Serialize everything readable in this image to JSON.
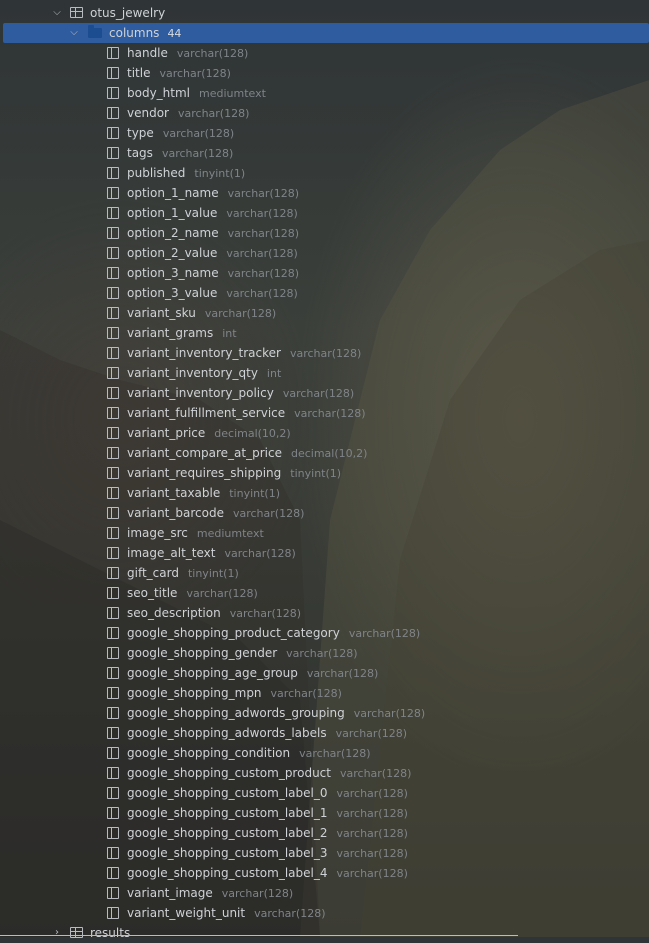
{
  "tree": {
    "table": {
      "name": "otus_jewelry",
      "expanded": true,
      "icon": "table-icon"
    },
    "columns_folder": {
      "label": "columns",
      "count": "44",
      "expanded": true,
      "selected": true,
      "icon": "folder-icon",
      "selected_color": "#2f5c9e"
    },
    "columns": [
      {
        "name": "handle",
        "type": "varchar(128)"
      },
      {
        "name": "title",
        "type": "varchar(128)"
      },
      {
        "name": "body_html",
        "type": "mediumtext"
      },
      {
        "name": "vendor",
        "type": "varchar(128)"
      },
      {
        "name": "type",
        "type": "varchar(128)"
      },
      {
        "name": "tags",
        "type": "varchar(128)"
      },
      {
        "name": "published",
        "type": "tinyint(1)"
      },
      {
        "name": "option_1_name",
        "type": "varchar(128)"
      },
      {
        "name": "option_1_value",
        "type": "varchar(128)"
      },
      {
        "name": "option_2_name",
        "type": "varchar(128)"
      },
      {
        "name": "option_2_value",
        "type": "varchar(128)"
      },
      {
        "name": "option_3_name",
        "type": "varchar(128)"
      },
      {
        "name": "option_3_value",
        "type": "varchar(128)"
      },
      {
        "name": "variant_sku",
        "type": "varchar(128)"
      },
      {
        "name": "variant_grams",
        "type": "int"
      },
      {
        "name": "variant_inventory_tracker",
        "type": "varchar(128)"
      },
      {
        "name": "variant_inventory_qty",
        "type": "int"
      },
      {
        "name": "variant_inventory_policy",
        "type": "varchar(128)"
      },
      {
        "name": "variant_fulfillment_service",
        "type": "varchar(128)"
      },
      {
        "name": "variant_price",
        "type": "decimal(10,2)"
      },
      {
        "name": "variant_compare_at_price",
        "type": "decimal(10,2)"
      },
      {
        "name": "variant_requires_shipping",
        "type": "tinyint(1)"
      },
      {
        "name": "variant_taxable",
        "type": "tinyint(1)"
      },
      {
        "name": "variant_barcode",
        "type": "varchar(128)"
      },
      {
        "name": "image_src",
        "type": "mediumtext"
      },
      {
        "name": "image_alt_text",
        "type": "varchar(128)"
      },
      {
        "name": "gift_card",
        "type": "tinyint(1)"
      },
      {
        "name": "seo_title",
        "type": "varchar(128)"
      },
      {
        "name": "seo_description",
        "type": "varchar(128)"
      },
      {
        "name": "google_shopping_product_category",
        "type": "varchar(128)"
      },
      {
        "name": "google_shopping_gender",
        "type": "varchar(128)"
      },
      {
        "name": "google_shopping_age_group",
        "type": "varchar(128)"
      },
      {
        "name": "google_shopping_mpn",
        "type": "varchar(128)"
      },
      {
        "name": "google_shopping_adwords_grouping",
        "type": "varchar(128)"
      },
      {
        "name": "google_shopping_adwords_labels",
        "type": "varchar(128)"
      },
      {
        "name": "google_shopping_condition",
        "type": "varchar(128)"
      },
      {
        "name": "google_shopping_custom_product",
        "type": "varchar(128)"
      },
      {
        "name": "google_shopping_custom_label_0",
        "type": "varchar(128)"
      },
      {
        "name": "google_shopping_custom_label_1",
        "type": "varchar(128)"
      },
      {
        "name": "google_shopping_custom_label_2",
        "type": "varchar(128)"
      },
      {
        "name": "google_shopping_custom_label_3",
        "type": "varchar(128)"
      },
      {
        "name": "google_shopping_custom_label_4",
        "type": "varchar(128)"
      },
      {
        "name": "variant_image",
        "type": "varchar(128)"
      },
      {
        "name": "variant_weight_unit",
        "type": "varchar(128)"
      }
    ],
    "next_table": {
      "name": "results",
      "expanded": false,
      "icon": "table-icon"
    }
  }
}
